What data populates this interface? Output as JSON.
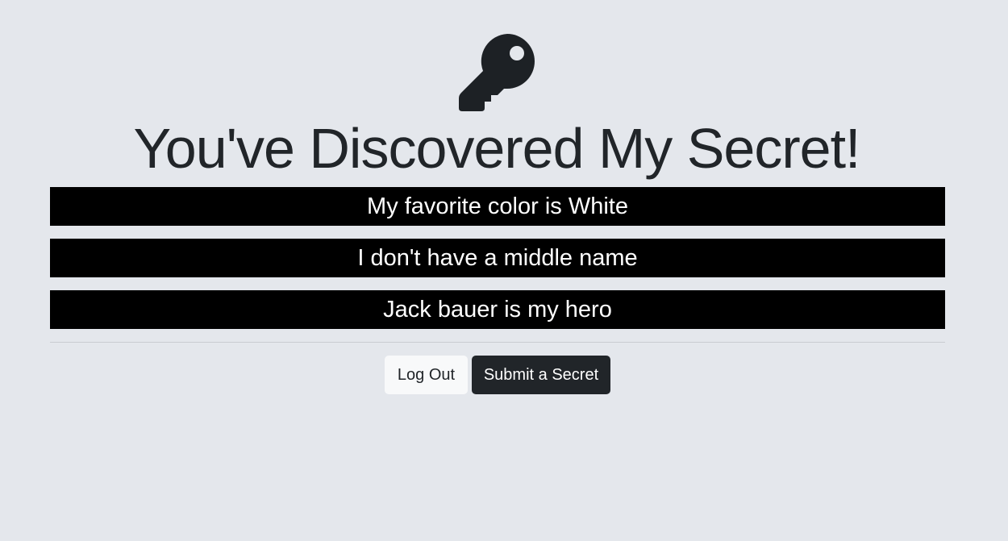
{
  "header": {
    "icon": "key-icon",
    "title": "You've Discovered My Secret!"
  },
  "secrets": [
    "My favorite color is White",
    "I don't have a middle name",
    "Jack bauer is my hero"
  ],
  "actions": {
    "logout_label": "Log Out",
    "submit_label": "Submit a Secret"
  },
  "colors": {
    "background": "#e4e7ec",
    "secret_bg": "#000000",
    "secret_text": "#ffffff",
    "dark_button": "#212529",
    "light_button": "#f8f9fa"
  }
}
